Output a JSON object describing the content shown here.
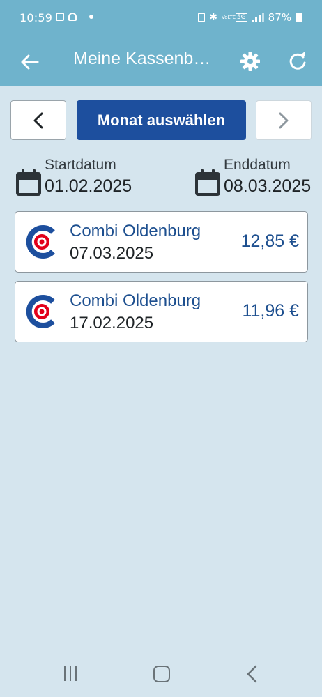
{
  "status_bar": {
    "time": "10:59",
    "battery": "87%",
    "network_badges": [
      "VoLTE",
      "5G"
    ]
  },
  "app_bar": {
    "title": "Meine Kassenbelege",
    "back_icon": "arrow-left-icon",
    "settings_icon": "gear-icon",
    "refresh_icon": "refresh-icon"
  },
  "month_nav": {
    "prev_icon": "chevron-left-icon",
    "select_label": "Monat auswählen",
    "next_icon": "chevron-right-icon"
  },
  "date_range": {
    "start_label": "Startdatum",
    "start_value": "01.02.2025",
    "end_label": "Enddatum",
    "end_value": "08.03.2025"
  },
  "receipts": [
    {
      "store": "Combi Oldenburg",
      "date": "07.03.2025",
      "amount": "12,85 €"
    },
    {
      "store": "Combi Oldenburg",
      "date": "17.02.2025",
      "amount": "11,96 €"
    }
  ],
  "colors": {
    "app_bar": "#6fb3cc",
    "background": "#d5e5ee",
    "primary_button": "#1d4f9e",
    "store_text": "#1d4f8f",
    "logo_blue": "#1d4f9e",
    "logo_red": "#e2001a"
  }
}
